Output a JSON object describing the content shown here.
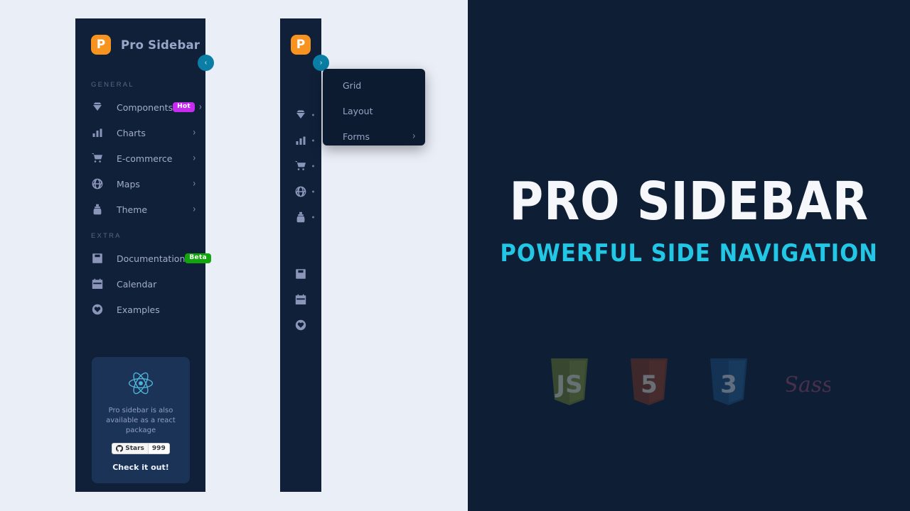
{
  "brand": {
    "initial": "P",
    "name": "Pro Sidebar"
  },
  "toggles": {
    "collapse_label": "‹",
    "expand_label": "›"
  },
  "sidebar": {
    "sections": [
      {
        "title": "GENERAL",
        "items": [
          {
            "label": "Components",
            "icon": "diamond-icon",
            "badge": "Hot",
            "badge_type": "hot",
            "chevron": "›"
          },
          {
            "label": "Charts",
            "icon": "bar-chart-icon",
            "badge": "",
            "badge_type": "",
            "chevron": "›"
          },
          {
            "label": "E-commerce",
            "icon": "shopping-cart-icon",
            "badge": "",
            "badge_type": "",
            "chevron": "›"
          },
          {
            "label": "Maps",
            "icon": "globe-icon",
            "badge": "",
            "badge_type": "",
            "chevron": "›"
          },
          {
            "label": "Theme",
            "icon": "ink-bottle-icon",
            "badge": "",
            "badge_type": "",
            "chevron": "›"
          }
        ]
      },
      {
        "title": "EXTRA",
        "items": [
          {
            "label": "Documentation",
            "icon": "book-icon",
            "badge": "Beta",
            "badge_type": "beta",
            "chevron": ""
          },
          {
            "label": "Calendar",
            "icon": "calendar-icon",
            "badge": "",
            "badge_type": "",
            "chevron": ""
          },
          {
            "label": "Examples",
            "icon": "service-heart-icon",
            "badge": "",
            "badge_type": "",
            "chevron": ""
          }
        ]
      }
    ]
  },
  "popup_submenu": {
    "items": [
      {
        "label": "Grid",
        "chevron": ""
      },
      {
        "label": "Layout",
        "chevron": ""
      },
      {
        "label": "Forms",
        "chevron": "›"
      }
    ]
  },
  "promo": {
    "logo": "react-logo",
    "text": "Pro sidebar is also available as a react package",
    "github_label": "Stars",
    "github_count": "999",
    "cta": "Check it out!"
  },
  "hero": {
    "title": "PRO SIDEBAR",
    "subtitle": "POWERFUL SIDE NAVIGATION",
    "logos": [
      {
        "name": "javascript-logo",
        "label": "JS"
      },
      {
        "name": "html5-logo",
        "label": "5"
      },
      {
        "name": "css3-logo",
        "label": "3"
      },
      {
        "name": "sass-logo",
        "label": "Sass"
      }
    ]
  },
  "colors": {
    "page_bg": "#eaeef7",
    "sidebar_bg": "#0f2038",
    "hero_bg": "#0e1e35",
    "accent_orange": "#f8931f",
    "accent_teal": "#0a7ea4",
    "accent_cyan": "#22c7e6",
    "badge_hot": "#c52cf0",
    "badge_beta": "#11a60b",
    "promo_card": "#1b3356"
  }
}
